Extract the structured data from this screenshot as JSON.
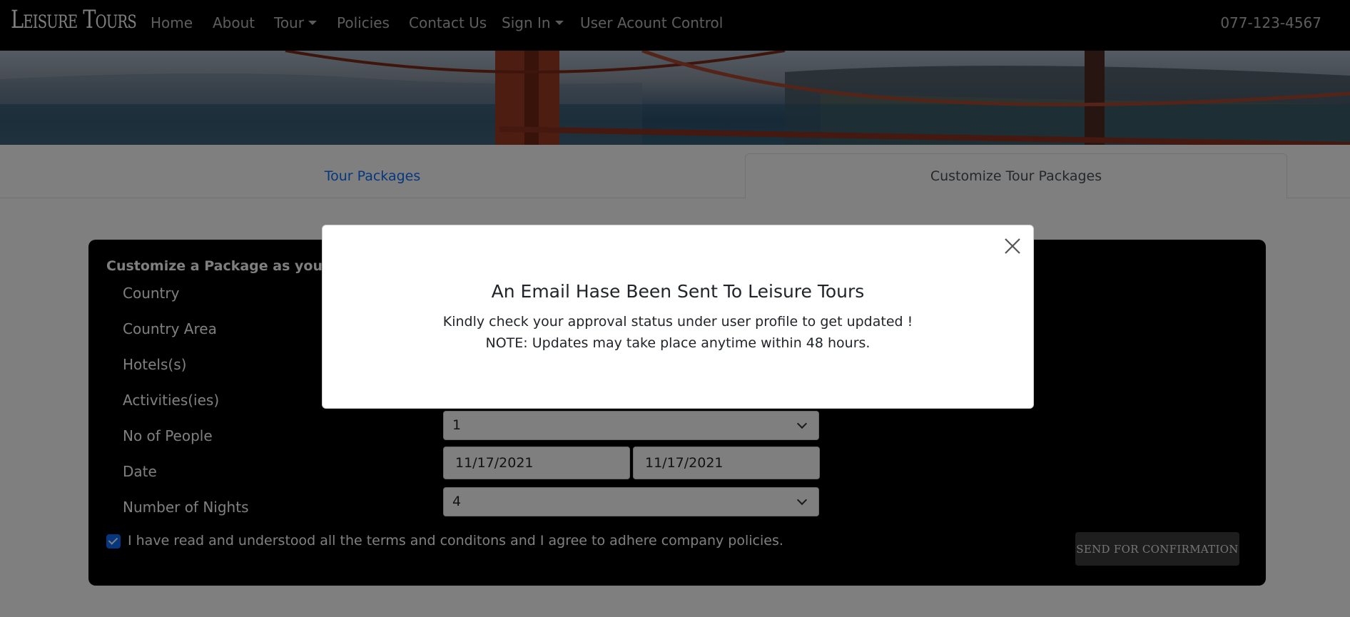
{
  "navbar": {
    "brand": "Leisure Tours",
    "items": [
      {
        "label": "Home"
      },
      {
        "label": "About"
      },
      {
        "label": "Tour",
        "dropdown": true
      },
      {
        "label": "Policies"
      },
      {
        "label": "Contact Us"
      },
      {
        "label": "Sign In",
        "dropdown": true
      },
      {
        "label": "User Acount Control"
      }
    ],
    "phone": "077-123-4567"
  },
  "tabs": [
    {
      "label": "Tour Packages",
      "active": false
    },
    {
      "label": "Customize Tour Packages",
      "active": true
    }
  ],
  "form": {
    "title": "Customize a Package as you wish",
    "labels": {
      "country": "Country",
      "country_area": "Country Area",
      "hotels": "Hotels(s)",
      "activities": "Activities(ies)",
      "no_of_people": "No of People",
      "date": "Date",
      "nights": "Number of Nights"
    },
    "no_of_people_value": "1",
    "date_from": "11/17/2021",
    "date_to": "11/17/2021",
    "nights_value": "4",
    "terms_checked": true,
    "terms_text": "I have read and understood all the terms and conditons and I agree to adhere company policies.",
    "submit_label": "SEND FOR CONFIRMATION"
  },
  "modal": {
    "title": "An Email Hase Been Sent To Leisure Tours",
    "line1": "Kindly check your approval status under user profile to get updated !",
    "line2": "NOTE: Updates may take place anytime within 48 hours."
  },
  "colors": {
    "accent": "#0d6efd",
    "navbar_bg": "#000000",
    "card_bg": "#000000"
  }
}
